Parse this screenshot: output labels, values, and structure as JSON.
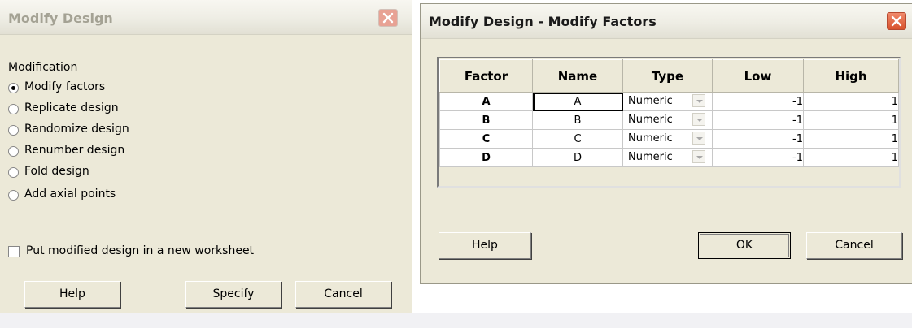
{
  "left_dialog": {
    "title": "Modify Design",
    "modification_label": "Modification",
    "options": [
      {
        "label": "Modify factors",
        "selected": true
      },
      {
        "label": "Replicate design",
        "selected": false
      },
      {
        "label": "Randomize design",
        "selected": false
      },
      {
        "label": "Renumber design",
        "selected": false
      },
      {
        "label": "Fold design",
        "selected": false
      },
      {
        "label": "Add axial points",
        "selected": false
      }
    ],
    "new_worksheet_label": "Put modified design in a new worksheet",
    "new_worksheet_checked": false,
    "buttons": {
      "help": "Help",
      "specify": "Specify",
      "cancel": "Cancel"
    }
  },
  "right_dialog": {
    "title": "Modify Design - Modify Factors",
    "columns": [
      "Factor",
      "Name",
      "Type",
      "Low",
      "High"
    ],
    "rows": [
      {
        "factor": "A",
        "name": "A",
        "type": "Numeric",
        "low": "-1",
        "high": "1"
      },
      {
        "factor": "B",
        "name": "B",
        "type": "Numeric",
        "low": "-1",
        "high": "1"
      },
      {
        "factor": "C",
        "name": "C",
        "type": "Numeric",
        "low": "-1",
        "high": "1"
      },
      {
        "factor": "D",
        "name": "D",
        "type": "Numeric",
        "low": "-1",
        "high": "1"
      }
    ],
    "buttons": {
      "help": "Help",
      "ok": "OK",
      "cancel": "Cancel"
    }
  }
}
